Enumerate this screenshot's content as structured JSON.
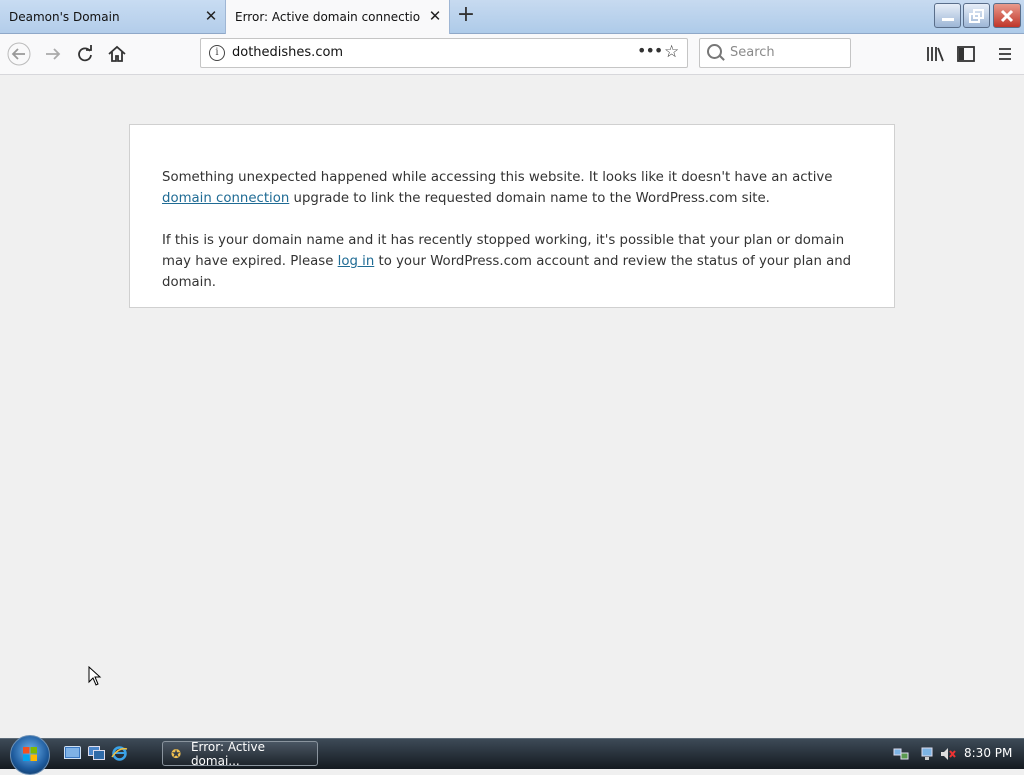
{
  "tabs": [
    {
      "label": "Deamon's Domain",
      "close": "✕"
    },
    {
      "label": "Error: Active domain connection for",
      "close": "✕"
    }
  ],
  "new_tab": "+",
  "window_controls": {
    "minimize": "—",
    "maximize": "❐",
    "close": "✕"
  },
  "nav": {
    "back_icon": "arrow-left-icon",
    "forward_icon": "arrow-right-icon",
    "reload_icon": "reload-icon",
    "home_icon": "home-icon",
    "url": "dothedishes.com",
    "page_actions": "•••",
    "bookmark_star": "☆",
    "search_placeholder": "Search",
    "library_icon": "library-icon",
    "sidebar_icon": "sidebar-icon",
    "menu_icon": "hamburger-menu-icon"
  },
  "content": {
    "p1_before": "Something unexpected happened while accessing this website. It looks like it doesn't have an active ",
    "p1_link": "domain connection",
    "p1_after": " upgrade to link the requested domain name to the WordPress.com site.",
    "p2_before": "If this is your domain name and it has recently stopped working, it's possible that your plan or domain may have expired. Please ",
    "p2_link": "log in",
    "p2_after": " to your WordPress.com account and review the status of your plan and domain.",
    "link_color": "#1f6b94"
  },
  "taskbar": {
    "task_label": "Error: Active domai...",
    "clock": "8:30 PM"
  }
}
